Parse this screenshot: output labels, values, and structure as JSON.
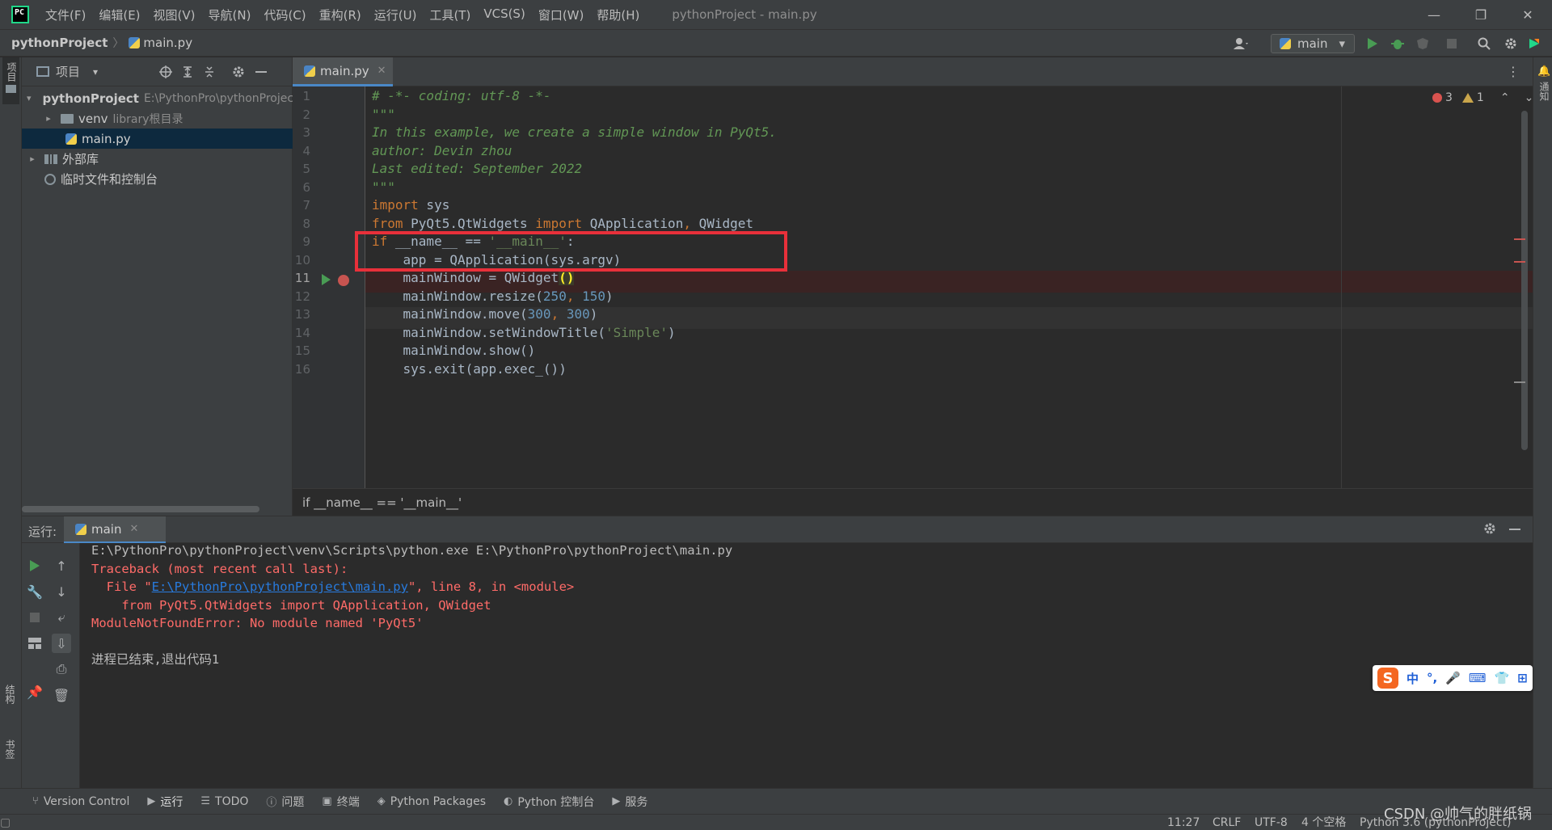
{
  "window": {
    "title": "pythonProject - main.py",
    "logo_text": "PC",
    "minimize": "—",
    "restore": "❐",
    "close": "✕"
  },
  "menu": [
    "文件(F)",
    "编辑(E)",
    "视图(V)",
    "导航(N)",
    "代码(C)",
    "重构(R)",
    "运行(U)",
    "工具(T)",
    "VCS(S)",
    "窗口(W)",
    "帮助(H)"
  ],
  "breadcrumb": {
    "project": "pythonProject",
    "separator": "〉",
    "file": "main.py"
  },
  "run_config": {
    "name": "main",
    "arrow": "▾"
  },
  "side_labels": {
    "project": "项目",
    "notifications": "通知",
    "structure": "结构",
    "bookmarks": "书签"
  },
  "project_panel": {
    "title": "项目",
    "title_arrow": "▾",
    "tree": [
      {
        "label": "pythonProject",
        "extra": "E:\\PythonPro\\pythonProject",
        "chevron": "▾",
        "bold": true
      },
      {
        "label": "venv",
        "extra": "library根目录",
        "chevron": "▸"
      },
      {
        "label": "main.py",
        "extra": "",
        "chevron": ""
      },
      {
        "label": "外部库",
        "extra": "",
        "chevron": "▸"
      },
      {
        "label": "临时文件和控制台",
        "extra": "",
        "chevron": ""
      }
    ]
  },
  "editor": {
    "tab_label": "main.py",
    "tab_close": "✕",
    "menu_icon": "⋮",
    "errors": "3",
    "warnings": "1",
    "breadcrumb": "if __name__ == '__main__'",
    "current_line": 11,
    "line_numbers": [
      "1",
      "2",
      "3",
      "4",
      "5",
      "6",
      "7",
      "8",
      "9",
      "10",
      "11",
      "12",
      "13",
      "14",
      "15",
      "16"
    ],
    "lines": [
      [
        {
          "t": "# -*- coding: utf-8 -*-",
          "c": "cm"
        }
      ],
      [
        {
          "t": "\"\"\"",
          "c": "cm"
        }
      ],
      [
        {
          "t": "In this example, we create a simple window in PyQt5.",
          "c": "cm"
        }
      ],
      [
        {
          "t": "author: Devin zhou",
          "c": "cm"
        }
      ],
      [
        {
          "t": "Last edited: September 2022",
          "c": "cm"
        }
      ],
      [
        {
          "t": "\"\"\"",
          "c": "cm"
        }
      ],
      [
        {
          "t": "import",
          "c": "kw"
        },
        {
          "t": " sys",
          "c": ""
        }
      ],
      [
        {
          "t": "from",
          "c": "kw"
        },
        {
          "t": " PyQt5.QtWidgets ",
          "c": ""
        },
        {
          "t": "import",
          "c": "kw"
        },
        {
          "t": " QApplication",
          "c": ""
        },
        {
          "t": ",",
          "c": "kw"
        },
        {
          "t": " QWidget",
          "c": ""
        }
      ],
      [
        {
          "t": "if",
          "c": "kw"
        },
        {
          "t": " __name__ == ",
          "c": ""
        },
        {
          "t": "'__main__'",
          "c": "str"
        },
        {
          "t": ":",
          "c": ""
        }
      ],
      [
        {
          "t": "    app = QApplication(sys.argv)",
          "c": ""
        }
      ],
      [
        {
          "t": "    mainWindow = QWidget",
          "c": ""
        },
        {
          "t": "()",
          "c": "hl"
        }
      ],
      [
        {
          "t": "    mainWindow.resize(",
          "c": ""
        },
        {
          "t": "250",
          "c": "num"
        },
        {
          "t": ", ",
          "c": "kw"
        },
        {
          "t": "150",
          "c": "num"
        },
        {
          "t": ")",
          "c": ""
        }
      ],
      [
        {
          "t": "    mainWindow.move(",
          "c": ""
        },
        {
          "t": "300",
          "c": "num"
        },
        {
          "t": ", ",
          "c": "kw"
        },
        {
          "t": "300",
          "c": "num"
        },
        {
          "t": ")",
          "c": ""
        }
      ],
      [
        {
          "t": "    mainWindow.setWindowTitle(",
          "c": ""
        },
        {
          "t": "'Simple'",
          "c": "str"
        },
        {
          "t": ")",
          "c": ""
        }
      ],
      [
        {
          "t": "    mainWindow.show()",
          "c": ""
        }
      ],
      [
        {
          "t": "    sys.exit(app.exec_())",
          "c": ""
        }
      ]
    ]
  },
  "run_panel": {
    "label": "运行:",
    "tab_label": "main",
    "tab_close": "✕",
    "console": [
      {
        "t": "E:\\PythonPro\\pythonProject\\venv\\Scripts\\python.exe E:\\PythonPro\\pythonProject\\main.py",
        "c": "con-norm"
      },
      {
        "t": "Traceback (most recent call last):",
        "c": "con-err"
      },
      {
        "parts": [
          {
            "t": "  File \"",
            "c": "con-err"
          },
          {
            "t": "E:\\PythonPro\\pythonProject\\main.py",
            "c": "con-link"
          },
          {
            "t": "\", line 8, in <module>",
            "c": "con-err"
          }
        ]
      },
      {
        "t": "    from PyQt5.QtWidgets import QApplication, QWidget",
        "c": "con-err"
      },
      {
        "t": "ModuleNotFoundError: No module named 'PyQt5'",
        "c": "con-err"
      },
      {
        "t": "",
        "c": "con-norm"
      },
      {
        "t": "进程已结束,退出代码1",
        "c": "con-norm"
      }
    ]
  },
  "ime": {
    "logo": "S",
    "items": [
      "中",
      "°,",
      "🎤",
      "⌨",
      "👕",
      "⊞"
    ]
  },
  "bottom_tools": [
    {
      "glyph": "⑂",
      "label": "Version Control"
    },
    {
      "glyph": "▶",
      "label": "运行",
      "active": true
    },
    {
      "glyph": "☰",
      "label": "TODO"
    },
    {
      "glyph": "ⓘ",
      "label": "问题"
    },
    {
      "glyph": "▣",
      "label": "终端"
    },
    {
      "glyph": "◈",
      "label": "Python Packages"
    },
    {
      "glyph": "◐",
      "label": "Python 控制台"
    },
    {
      "glyph": "▶",
      "label": "服务"
    }
  ],
  "statusbar": {
    "position": "11:27",
    "line_sep": "CRLF",
    "encoding": "UTF-8",
    "indent": "4 个空格",
    "interpreter": "Python 3.6 (pythonProject)"
  },
  "watermark": "CSDN @帅气的胖纸锅",
  "colors": {
    "annotation": "#e8303a",
    "error_text": "#ff6b68",
    "run_green": "#499c54",
    "breakpoint": "#c75450"
  }
}
